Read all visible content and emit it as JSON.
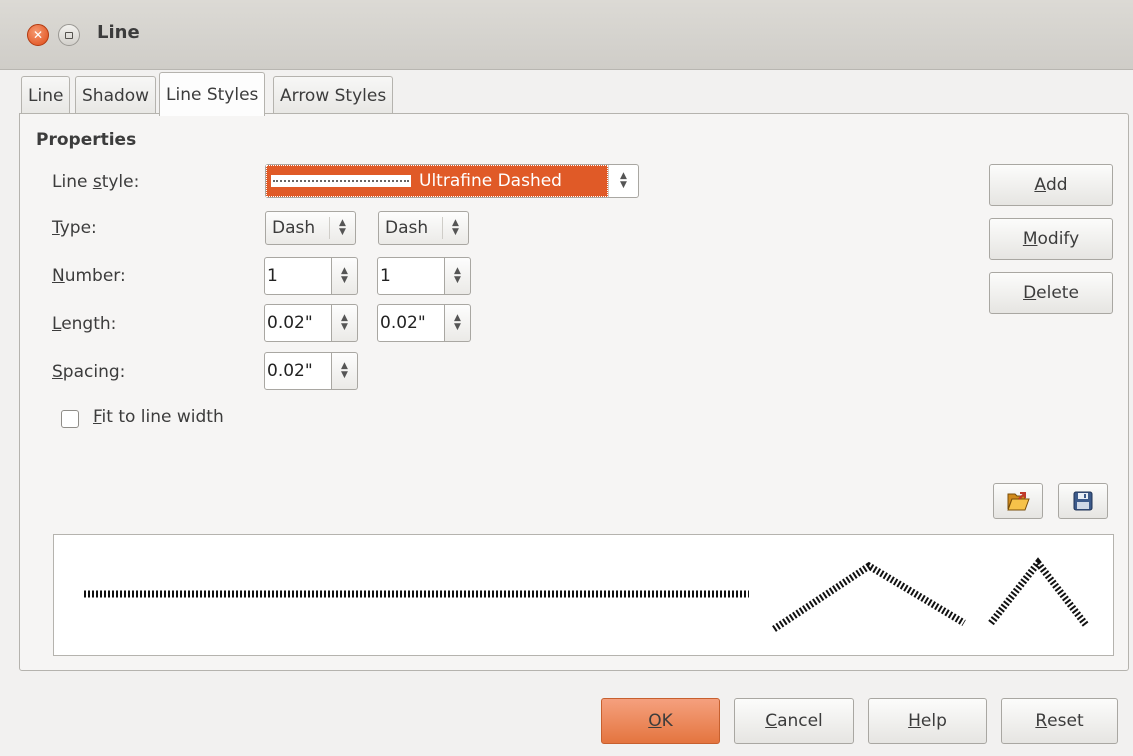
{
  "window": {
    "title": "Line"
  },
  "tabs": [
    {
      "label": "Line"
    },
    {
      "label": "Shadow"
    },
    {
      "label": "Line Styles",
      "active": true
    },
    {
      "label": "Arrow Styles"
    }
  ],
  "properties": {
    "heading": "Properties",
    "line_style": {
      "label_pre": "Line ",
      "label_mnemonic": "s",
      "label_post": "tyle:",
      "value": "Ultrafine Dashed"
    },
    "type": {
      "label_mnemonic": "T",
      "label_post": "ype:",
      "value1": "Dash",
      "value2": "Dash"
    },
    "number": {
      "label_mnemonic": "N",
      "label_post": "umber:",
      "value1": "1",
      "value2": "1"
    },
    "length": {
      "label_mnemonic": "L",
      "label_post": "ength:",
      "value1": "0.02\"",
      "value2": "0.02\""
    },
    "spacing": {
      "label_mnemonic": "S",
      "label_post": "pacing:",
      "value": "0.02\""
    },
    "fit_to_line_width": {
      "label_mnemonic": "F",
      "label_post": "it to line width",
      "checked": false
    }
  },
  "side_buttons": {
    "add": {
      "mnemonic": "A",
      "rest": "dd"
    },
    "modify": {
      "mnemonic": "M",
      "rest": "odify"
    },
    "delete": {
      "mnemonic": "D",
      "rest": "elete"
    }
  },
  "icons": {
    "load": "open-folder-icon",
    "save": "floppy-disk-icon"
  },
  "footer": {
    "ok": {
      "mnemonic": "O",
      "rest": "K"
    },
    "cancel": {
      "mnemonic": "C",
      "rest": "ancel"
    },
    "help": {
      "mnemonic": "H",
      "rest": "elp"
    },
    "reset": {
      "mnemonic": "R",
      "rest": "eset"
    }
  },
  "colors": {
    "accent": "#e05a27",
    "primary_button": "#e4753f"
  }
}
